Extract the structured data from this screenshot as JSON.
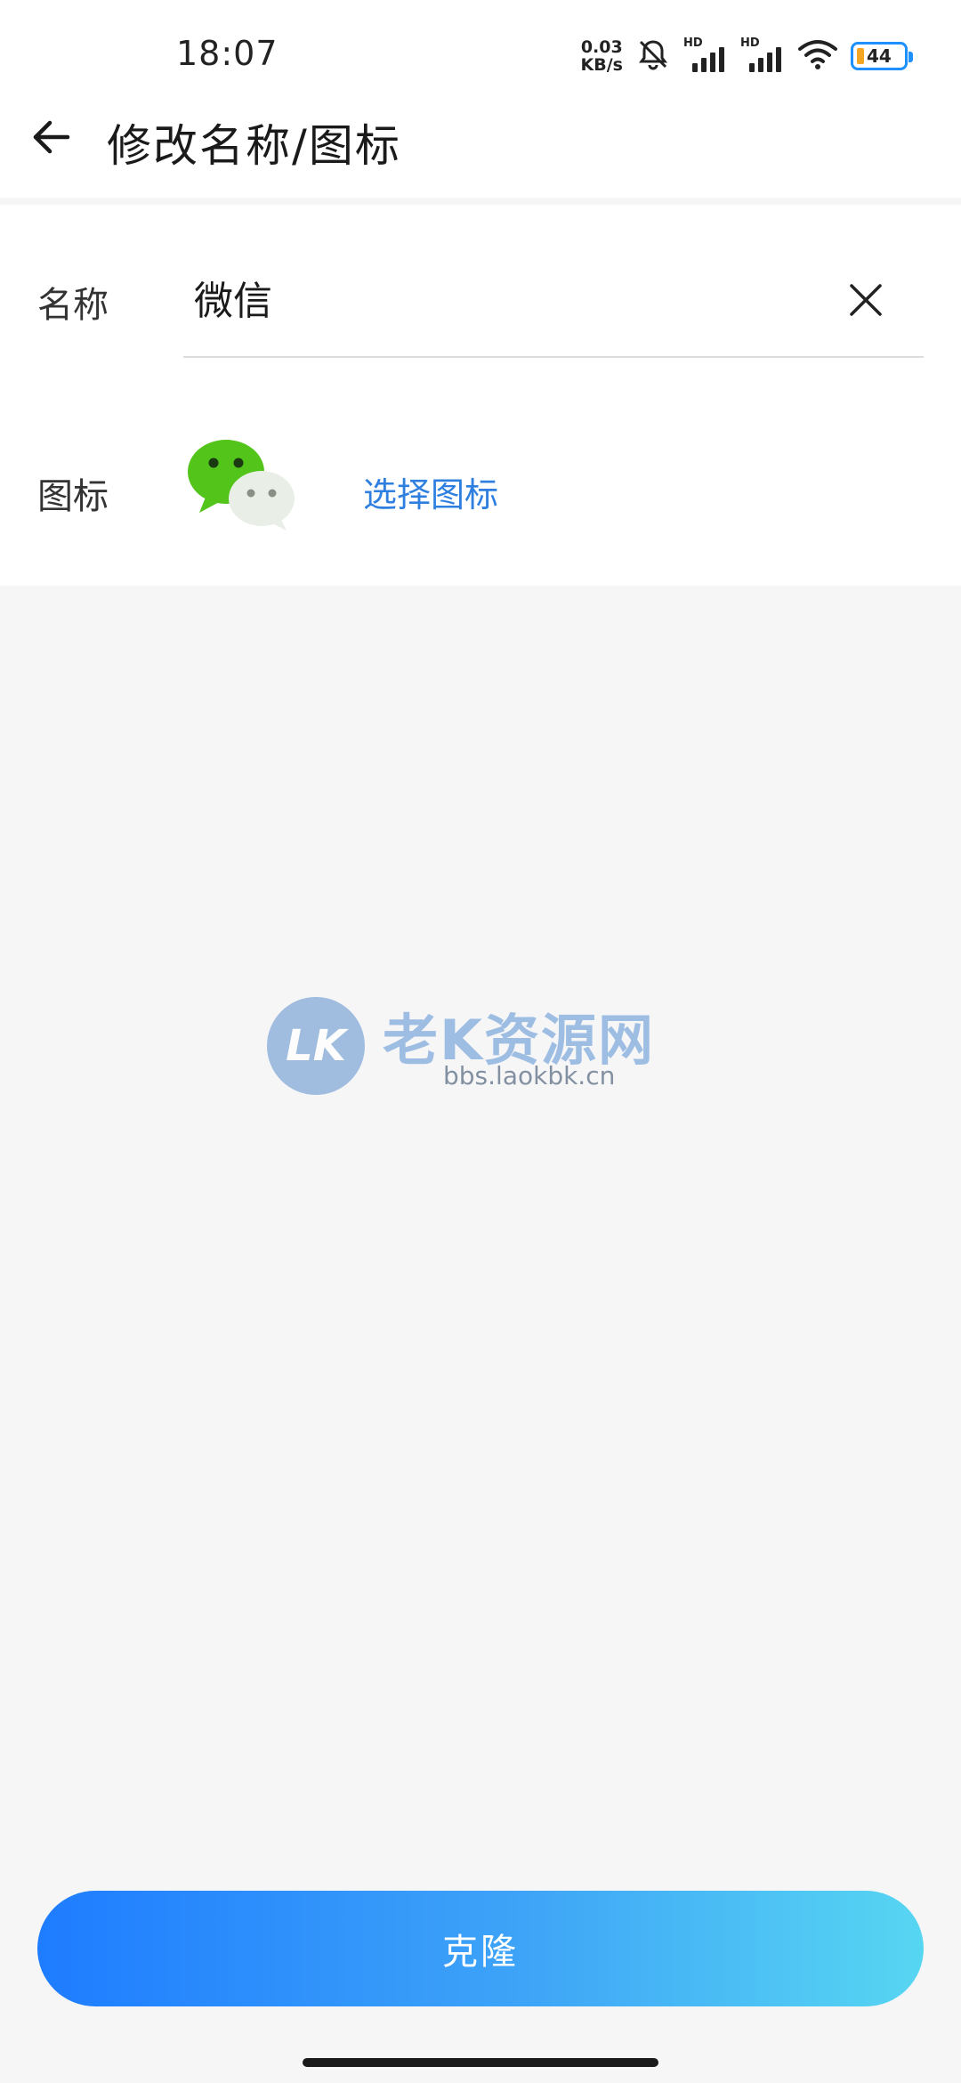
{
  "status_bar": {
    "time": "18:07",
    "net_speed_value": "0.03",
    "net_speed_unit": "KB/s",
    "sim1_label": "HD",
    "sim2_label": "HD",
    "battery_level": "44"
  },
  "header": {
    "title": "修改名称/图标",
    "back_icon": "back-arrow-icon"
  },
  "form": {
    "name_label": "名称",
    "name_value": "微信",
    "clear_icon": "close-icon",
    "icon_label": "图标",
    "app_icon": "wechat-icon",
    "choose_icon_label": "选择图标"
  },
  "watermark": {
    "logo_text": "LK",
    "title": "老K资源网",
    "url": "bbs.laokbk.cn"
  },
  "actions": {
    "clone_label": "克隆"
  },
  "colors": {
    "accent": "#2f7fe0",
    "button_gradient_start": "#1e7cff",
    "button_gradient_end": "#57d6f2",
    "wechat_green": "#52c41a"
  }
}
